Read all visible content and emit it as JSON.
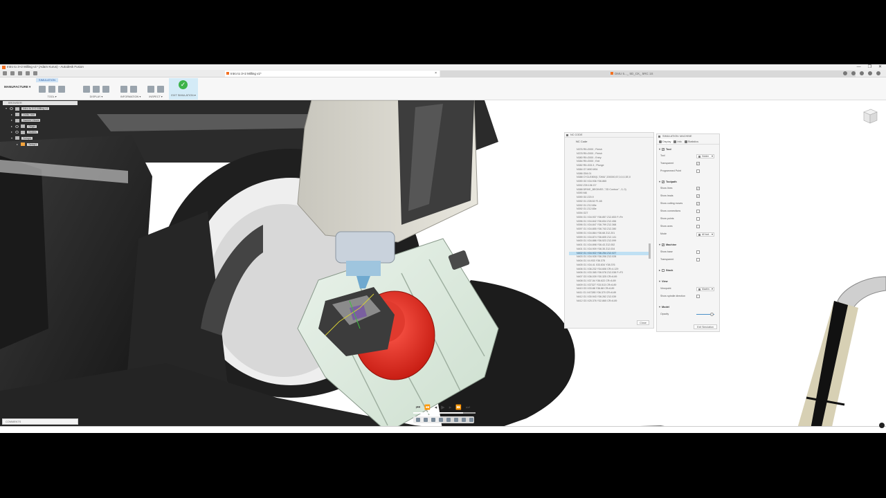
{
  "window": {
    "title": "Intro to 3+2 Milling v1* (Adam Kurus) - Autodesk Fusion",
    "controls": [
      "—",
      "❐",
      "✕"
    ]
  },
  "tabs": [
    {
      "label": "Intro to 3+2 Milling v1*",
      "active": true
    },
    {
      "label": "DMU 5..._ 5D_CK_ 5RC 1S",
      "active": false
    }
  ],
  "ribbon": {
    "workspace": "MANUFACTURE ▾",
    "active_tab": "SIMULATION",
    "groups": [
      {
        "label": "TOOL ▾"
      },
      {
        "label": "DISPLAY ▾"
      },
      {
        "label": "INFORMATION ▾"
      },
      {
        "label": "INSPECT ▾"
      }
    ],
    "exit_label": "EXIT SIMULATION ▾"
  },
  "browser": {
    "header": "BROWSER",
    "nodes": [
      {
        "label": "Intro to 3+2 Milling v1",
        "indent": 0
      },
      {
        "label": "Units: mm",
        "indent": 1
      },
      {
        "label": "Named Views",
        "indent": 1
      },
      {
        "label": "Origin",
        "indent": 1
      },
      {
        "label": "Bodies",
        "indent": 1
      },
      {
        "label": "Setups",
        "indent": 1
      },
      {
        "label": "Setup1",
        "indent": 2
      }
    ]
  },
  "nc_panel": {
    "header": "NC CODE",
    "title": "NC Code",
    "highlight_index": 26,
    "lines": [
      "N376 R0=2000 ; Finish",
      "N378 R0=2000 ; Finish",
      "N380 R0=2000 ; Entry",
      "N384 R0=2000 ; Exit",
      "N382 R0=333.3 ; Plunge",
      "N384 G7 M90 M94",
      "N386 G54.01",
      "N388 CYCLE800(1,\"DMU\",200000,57,0,0,0,3E,0",
      "N390 G0 X34.936 Y36.865",
      "N392 Z39.196 G7",
      "N388 DRIVE_BEGINSS ,\"2D Contour\" , 0, 0)",
      "N390 M8",
      "N390 G0 Z20.9",
      "N392 G1 Z28.52 F1.65",
      "N392 G1 Z12.65e",
      "N392 G1 Z12.65e",
      "N394 G27",
      "N394 G1 X34.937 Y36.857 Z12.653 F=Fe",
      "N396 G1 X34.842 Y36.834 Z12.456",
      "N396 G1 X34.847 Y36.799 Z12.368",
      "N397 G1 X34.855 Y36.743 Z12.280",
      "N398 G1 X34.864 Y36.68 Z12.201",
      "N399 G1 X34.874 Y36.605 Z12.141",
      "N400 G1 X34.886 Y36.523 Z12.099",
      "N401 G1 X34.898 Y36.43 Z12.052",
      "N401 G1 X34.909 Y36.35 Z12.034",
      "N402 G1 X34.922 Y36.254 Z12.027",
      "N403 G1 X34.928 Y36.206 Z12.028",
      "N404 G1 X4.933 Y36.375",
      "N405 G1 X34.41 X33.834 Y38.376",
      "N406 G1 X36.232 Y34.606 CR=4.129",
      "N406 G1 X33.365 Y36.578 Z12.038 F=F3",
      "N407 G3 X36.039 Y30.325 CR=6.89",
      "N408 G1 X37-54 Y36.622 CR=6.89",
      "N409 G1 X37327 Y33.513 CR=6.89",
      "N410 G3 X33.88 Y36.88 CR=6.89",
      "N411 G1 X47285 Y36.370 CR=6.89",
      "N412 G1 X30.943 Y36.262 Z12.039",
      "N412 G3 X25.376 Y32.865 CR=6.89"
    ],
    "close_label": "Close"
  },
  "sim_panel": {
    "header": "SIMULATION: MACHINE",
    "tabs": [
      "Display",
      "Info",
      "Statistics"
    ],
    "sections": {
      "tool": {
        "label": "Tool",
        "rows": [
          {
            "label": "Tool",
            "type": "select",
            "value": "Holder"
          },
          {
            "label": "Transparent",
            "type": "check",
            "checked": true
          },
          {
            "label": "Programmed Point",
            "type": "check",
            "checked": false
          }
        ]
      },
      "toolpath": {
        "label": "Toolpath",
        "rows": [
          {
            "label": "Show lines",
            "type": "check",
            "checked": true
          },
          {
            "label": "Show leads",
            "type": "check",
            "checked": true
          },
          {
            "label": "Show cutting moves",
            "type": "check",
            "checked": true
          },
          {
            "label": "Show connections",
            "type": "check",
            "checked": false
          },
          {
            "label": "Show points",
            "type": "check",
            "checked": false
          },
          {
            "label": "Show axes",
            "type": "check",
            "checked": false
          },
          {
            "label": "Mode",
            "type": "select",
            "value": "All tool..."
          }
        ]
      },
      "machine": {
        "label": "Machine",
        "rows": [
          {
            "label": "Show base",
            "type": "check",
            "checked": false
          },
          {
            "label": "Transparent",
            "type": "check",
            "checked": false
          }
        ]
      },
      "stock": {
        "label": "Stock"
      },
      "view": {
        "label": "View",
        "rows": [
          {
            "label": "Viewpoint",
            "type": "select",
            "value": "Machin..."
          },
          {
            "label": "Show spindle direction",
            "type": "check",
            "checked": false
          }
        ]
      },
      "model": {
        "label": "Model",
        "rows": [
          {
            "label": "Opacity",
            "type": "slider",
            "value": 0.85
          }
        ]
      }
    },
    "exit_label": "Exit Simulation"
  },
  "comment_label": "COMMENTS",
  "playback": {
    "progress": 0.8
  },
  "colors": {
    "fusion_orange": "#f37021",
    "exit_green": "#3db34a",
    "highlight_blue": "#bfe0f3",
    "fixture_red": "#d9261c",
    "table_green": "#dfeee0"
  },
  "icons": [
    "app-icon",
    "save-icon",
    "undo-icon",
    "redo-icon",
    "check-icon",
    "play-icon",
    "pause-icon",
    "step-back-icon",
    "step-forward-icon",
    "viewcube-icon",
    "help-icon"
  ]
}
